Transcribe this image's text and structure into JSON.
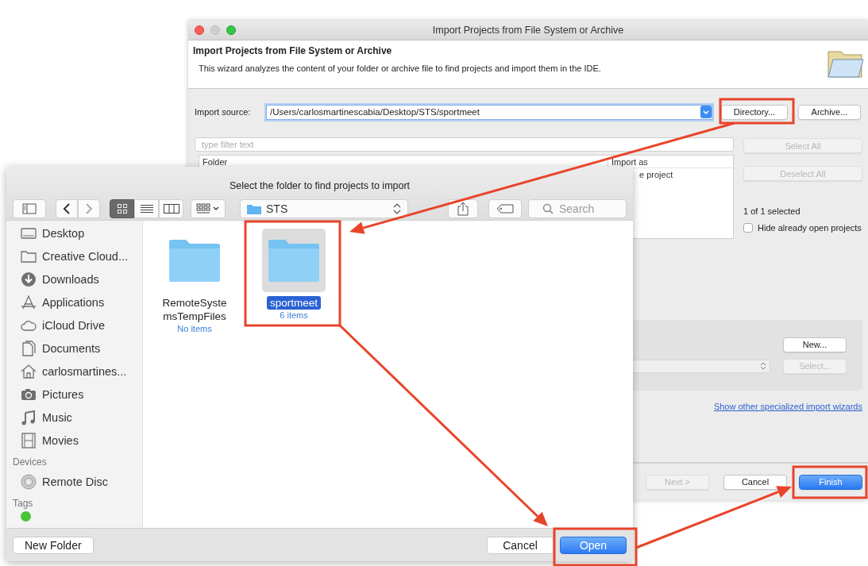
{
  "eclipse_window": {
    "title": "Import Projects from File System or Archive",
    "header": {
      "title": "Import Projects from File System or Archive",
      "description": "This wizard analyzes the content of your folder or archive file to find projects and import them in the IDE."
    },
    "import_source": {
      "label": "Import source:",
      "value": "/Users/carlosmartinescabia/Desktop/STS/sportmeet",
      "buttons": [
        {
          "label": "Directory...",
          "disabled": false
        },
        {
          "label": "Archive...",
          "disabled": false
        }
      ]
    },
    "filter": {
      "placeholder": "type filter text"
    },
    "table": {
      "columns": [
        "Folder",
        "Import as"
      ],
      "rows": [
        {
          "import_as": "e project"
        }
      ]
    },
    "side_buttons": [
      {
        "label": "Select All",
        "disabled": true
      },
      {
        "label": "Deselect All",
        "disabled": true
      }
    ],
    "selection_count": "1 of 1 selected",
    "hide_open": {
      "label": "Hide already open projects",
      "checked": false
    },
    "working_set": {
      "buttons": [
        {
          "label": "New...",
          "disabled": false
        },
        {
          "label": "Select...",
          "disabled": true
        }
      ]
    },
    "link": "Show other specialized import wizards",
    "footer_buttons": [
      {
        "label": "Next >",
        "disabled": true,
        "default": false
      },
      {
        "label": "Cancel",
        "disabled": false,
        "default": false
      },
      {
        "label": "Finish",
        "disabled": false,
        "default": true
      }
    ]
  },
  "finder_dialog": {
    "title": "Select the folder to find projects to import",
    "view_modes": [
      {
        "kind": "icons",
        "selected": true
      },
      {
        "kind": "list",
        "selected": false
      },
      {
        "kind": "columns",
        "selected": false
      }
    ],
    "path": "STS",
    "search": {
      "placeholder": "Search"
    },
    "sidebar": {
      "favorites": [
        {
          "kind": "desktop",
          "label": "Desktop"
        },
        {
          "kind": "folder",
          "label": "Creative Cloud..."
        },
        {
          "kind": "downloads",
          "label": "Downloads"
        },
        {
          "kind": "applications",
          "label": "Applications"
        },
        {
          "kind": "cloud",
          "label": "iCloud Drive"
        },
        {
          "kind": "documents",
          "label": "Documents"
        },
        {
          "kind": "home",
          "label": "carlosmartines..."
        },
        {
          "kind": "pictures",
          "label": "Pictures"
        },
        {
          "kind": "music",
          "label": "Music"
        },
        {
          "kind": "movies",
          "label": "Movies"
        }
      ],
      "devices": {
        "heading": "Devices",
        "items": [
          {
            "kind": "disc",
            "label": "Remote Disc"
          }
        ]
      },
      "tags": {
        "heading": "Tags",
        "items": [
          {
            "color": "#4cc43a"
          }
        ]
      }
    },
    "files": [
      {
        "name": "RemoteSystemsTempFiles",
        "info": "No items",
        "selected": false
      },
      {
        "name": "sportmeet",
        "info": "6 items",
        "selected": true
      }
    ],
    "new_folder": "New Folder",
    "buttons": [
      {
        "label": "Cancel",
        "default": false
      },
      {
        "label": "Open",
        "default": true
      }
    ]
  }
}
